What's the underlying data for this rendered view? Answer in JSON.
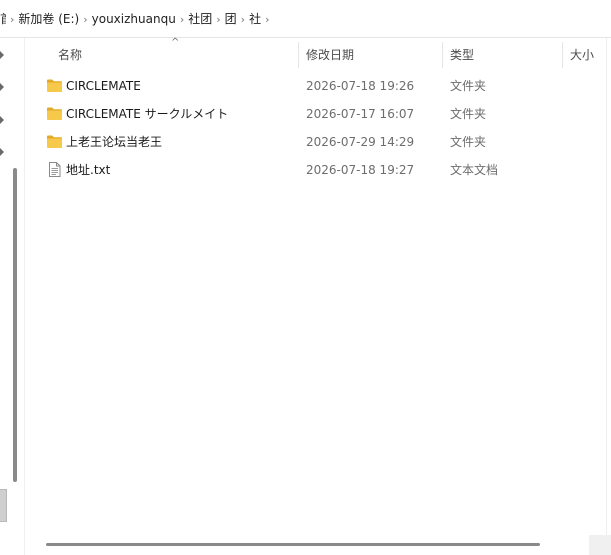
{
  "breadcrumb": {
    "cut_item": "首",
    "items": [
      "新加卷 (E:)",
      "youxizhuanqu",
      "社团",
      "团",
      "社"
    ],
    "separator": "›"
  },
  "columns": {
    "name": "名称",
    "date": "修改日期",
    "type": "类型",
    "size": "大小",
    "sort_indicator": "^"
  },
  "files": [
    {
      "name": "CIRCLEMATE",
      "date": "2026-07-18 19:26",
      "type": "文件夹",
      "icon": "folder-icon"
    },
    {
      "name": "CIRCLEMATE サークルメイト",
      "date": "2026-07-17 16:07",
      "type": "文件夹",
      "icon": "folder-icon"
    },
    {
      "name": "上老王论坛当老王",
      "date": "2026-07-29 14:29",
      "type": "文件夹",
      "icon": "folder-icon"
    },
    {
      "name": "地址.txt",
      "date": "2026-07-18 19:27",
      "type": "文本文档",
      "icon": "text-file-icon"
    }
  ],
  "colors": {
    "folder": "#f6c94a",
    "folder_dark": "#e3a92a",
    "text_secondary": "#6d6d6d"
  }
}
